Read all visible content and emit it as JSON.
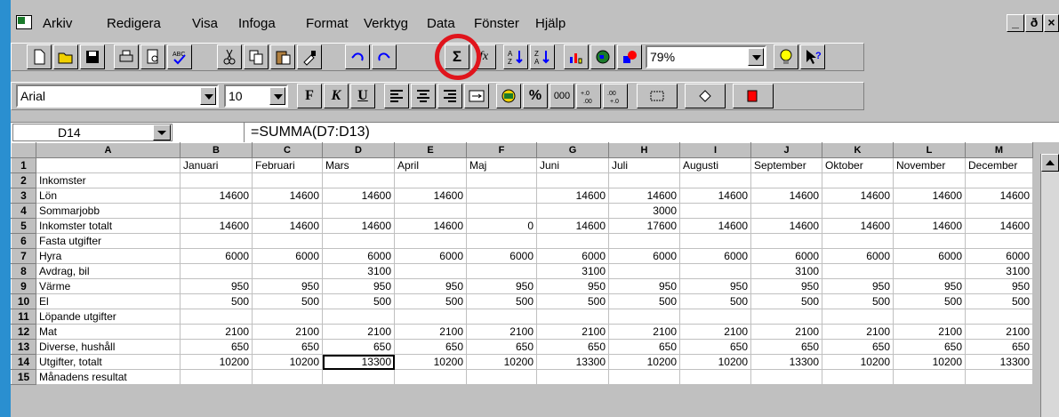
{
  "menu": [
    "Arkiv",
    "Redigera",
    "Visa",
    "Infoga",
    "Format",
    "Verktyg",
    "Data",
    "Fönster",
    "Hjälp"
  ],
  "window_controls": [
    "_",
    "ð",
    "×"
  ],
  "toolbar": {
    "zoom": "79%",
    "font": "Arial",
    "font_size": "10",
    "bold_label": "F",
    "italic_label": "K",
    "underline_label": "U",
    "percent_label": "%",
    "thousands_label": "000",
    "autosum_label": "Σ",
    "function_label": "fx",
    "highlight_color": "#e0141c"
  },
  "formula_bar": {
    "cell_ref": "D14",
    "formula": "=SUMMA(D7:D13)"
  },
  "grid": {
    "col_letters": [
      "A",
      "B",
      "C",
      "D",
      "E",
      "F",
      "G",
      "H",
      "I",
      "J",
      "K",
      "L",
      "M"
    ],
    "rows": [
      {
        "n": "1",
        "a": "",
        "v": [
          "Januari",
          "Februari",
          "Mars",
          "April",
          "Maj",
          "Juni",
          "Juli",
          "Augusti",
          "September",
          "Oktober",
          "November",
          "December"
        ]
      },
      {
        "n": "2",
        "a": "Inkomster",
        "v": [
          "",
          "",
          "",
          "",
          "",
          "",
          "",
          "",
          "",
          "",
          "",
          ""
        ]
      },
      {
        "n": "3",
        "a": "Lön",
        "v": [
          "14600",
          "14600",
          "14600",
          "14600",
          "",
          "14600",
          "14600",
          "14600",
          "14600",
          "14600",
          "14600",
          "14600"
        ]
      },
      {
        "n": "4",
        "a": "Sommarjobb",
        "v": [
          "",
          "",
          "",
          "",
          "",
          "",
          "3000",
          "",
          "",
          "",
          "",
          ""
        ]
      },
      {
        "n": "5",
        "a": "Inkomster totalt",
        "v": [
          "14600",
          "14600",
          "14600",
          "14600",
          "0",
          "14600",
          "17600",
          "14600",
          "14600",
          "14600",
          "14600",
          "14600"
        ]
      },
      {
        "n": "6",
        "a": "Fasta utgifter",
        "v": [
          "",
          "",
          "",
          "",
          "",
          "",
          "",
          "",
          "",
          "",
          "",
          ""
        ]
      },
      {
        "n": "7",
        "a": "Hyra",
        "v": [
          "6000",
          "6000",
          "6000",
          "6000",
          "6000",
          "6000",
          "6000",
          "6000",
          "6000",
          "6000",
          "6000",
          "6000"
        ]
      },
      {
        "n": "8",
        "a": "Avdrag, bil",
        "v": [
          "",
          "",
          "3100",
          "",
          "",
          "3100",
          "",
          "",
          "3100",
          "",
          "",
          "3100"
        ]
      },
      {
        "n": "9",
        "a": "Värme",
        "v": [
          "950",
          "950",
          "950",
          "950",
          "950",
          "950",
          "950",
          "950",
          "950",
          "950",
          "950",
          "950"
        ]
      },
      {
        "n": "10",
        "a": "El",
        "v": [
          "500",
          "500",
          "500",
          "500",
          "500",
          "500",
          "500",
          "500",
          "500",
          "500",
          "500",
          "500"
        ]
      },
      {
        "n": "11",
        "a": "Löpande utgifter",
        "v": [
          "",
          "",
          "",
          "",
          "",
          "",
          "",
          "",
          "",
          "",
          "",
          ""
        ]
      },
      {
        "n": "12",
        "a": "Mat",
        "v": [
          "2100",
          "2100",
          "2100",
          "2100",
          "2100",
          "2100",
          "2100",
          "2100",
          "2100",
          "2100",
          "2100",
          "2100"
        ]
      },
      {
        "n": "13",
        "a": "Diverse, hushåll",
        "v": [
          "650",
          "650",
          "650",
          "650",
          "650",
          "650",
          "650",
          "650",
          "650",
          "650",
          "650",
          "650"
        ]
      },
      {
        "n": "14",
        "a": "Utgifter, totalt",
        "v": [
          "10200",
          "10200",
          "13300",
          "10200",
          "10200",
          "13300",
          "10200",
          "10200",
          "13300",
          "10200",
          "10200",
          "13300"
        ]
      },
      {
        "n": "15",
        "a": "Månadens resultat",
        "v": [
          "",
          "",
          "",
          "",
          "",
          "",
          "",
          "",
          "",
          "",
          "",
          ""
        ]
      }
    ]
  }
}
